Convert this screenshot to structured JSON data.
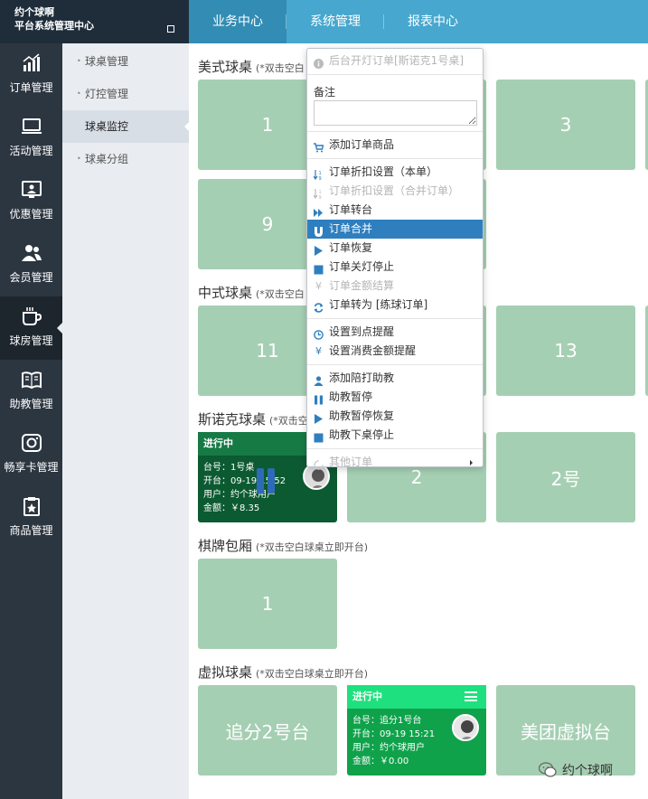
{
  "brand": {
    "line1": "约个球啊",
    "line2": "平台系统管理中心"
  },
  "topnav": [
    "业务中心",
    "系统管理",
    "报表中心"
  ],
  "rail": [
    "订单管理",
    "活动管理",
    "优惠管理",
    "会员管理",
    "球房管理",
    "助教管理",
    "畅享卡管理",
    "商品管理"
  ],
  "submenu": [
    "球桌管理",
    "灯控管理",
    "球桌监控",
    "球桌分组"
  ],
  "hint": "(*双击空白球桌立即开台)",
  "hint_short": "(*双击空白",
  "sections": {
    "american": {
      "title": "美式球桌",
      "tiles": [
        "1",
        "3",
        "9"
      ]
    },
    "chinese": {
      "title": "中式球桌",
      "tiles": [
        "11",
        "13"
      ]
    },
    "snooker": {
      "title": "斯诺克球桌",
      "tiles": [
        "2",
        "2号"
      ],
      "busy": {
        "status": "进行中",
        "table": "台号：1号桌",
        "open": "开台：09-19 15:52",
        "user": "用户：约个球用户",
        "amount": "金额：￥8.35"
      }
    },
    "chess": {
      "title": "棋牌包厢",
      "tiles": [
        "1"
      ]
    },
    "virtual": {
      "title": "虚拟球桌",
      "tiles": [
        "追分2号台",
        "美团虚拟台"
      ],
      "busy": {
        "status": "进行中",
        "table": "台号：追分1号台",
        "open": "开台：09-19 15:21",
        "user": "用户：约个球用户",
        "amount": "金额：￥0.00"
      }
    }
  },
  "context_menu": {
    "header": "后台开灯订单[斯诺克1号桌]",
    "note_label": "备注",
    "note_value": "",
    "items": {
      "add_goods": "添加订单商品",
      "discount_single": "订单折扣设置（本单）",
      "discount_merge": "订单折扣设置（合并订单）",
      "transfer": "订单转台",
      "merge": "订单合并",
      "resume": "订单恢复",
      "stop": "订单关灯停止",
      "settle": "订单金额结算",
      "to_practice": "订单转为 [练球订单]",
      "arrival_reminder": "设置到点提醒",
      "amount_reminder": "设置消费金额提醒",
      "add_coach": "添加陪打助教",
      "coach_pause": "助教暂停",
      "coach_resume": "助教暂停恢复",
      "coach_stop": "助教下桌停止",
      "other": "其他订单"
    }
  },
  "watermark": "约个球啊",
  "colors": {
    "tile_idle": "#a5cfb3",
    "tile_busy_dark": "#0c5a31",
    "tile_busy_bright": "#0fa24b",
    "menu_highlight": "#2f7fbf",
    "topnav": "#47a7ce"
  }
}
